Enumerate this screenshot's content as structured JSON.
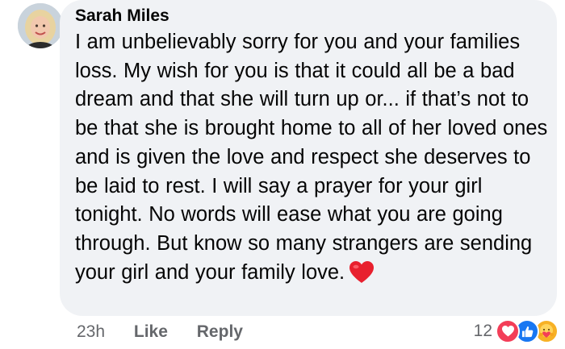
{
  "comment": {
    "author": "Sarah Miles",
    "text": "I am unbelievably sorry for you and your families loss. My wish for you is that it could all be a bad dream and that she will turn up or... if that’s not to be that she is brought home to all of her loved ones and is given the love and respect she deserves to be laid to rest. I will say a prayer for your girl tonight. No words will ease what you are going through. But know so many strangers are sending your girl and your family love.",
    "emoji": "red-heart",
    "timestamp": "23h",
    "like_label": "Like",
    "reply_label": "Reply",
    "reaction_count": "12",
    "reactions": [
      "love-icon",
      "like-icon",
      "care-icon"
    ]
  },
  "colors": {
    "bubble": "#f0f2f5",
    "text": "#050505",
    "secondary": "#65676b",
    "love": "#f33e58",
    "like": "#1877f2",
    "care": "#f7b125"
  }
}
